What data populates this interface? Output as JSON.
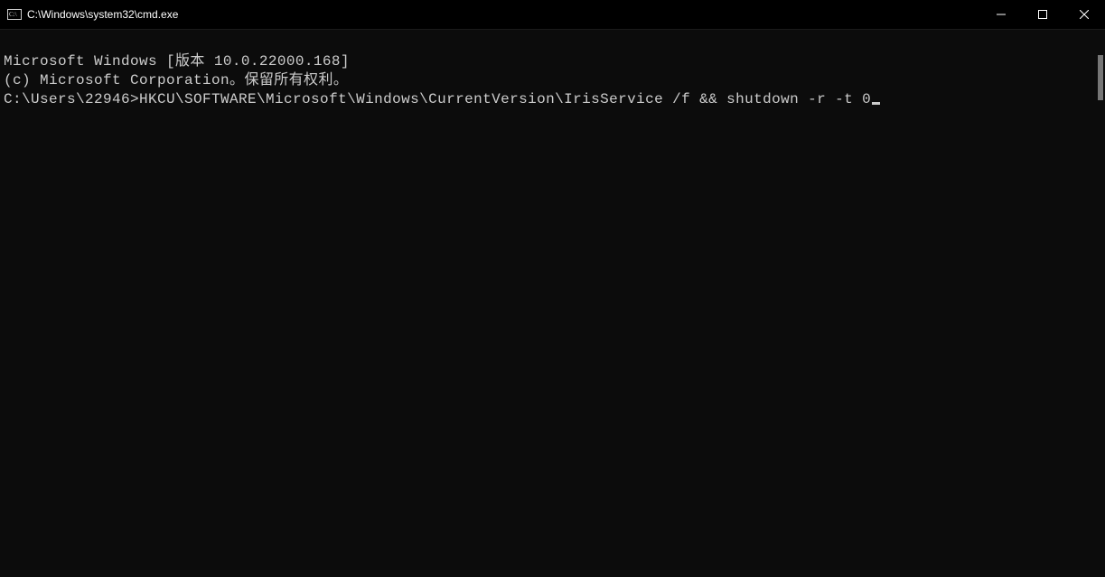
{
  "titlebar": {
    "title": "C:\\Windows\\system32\\cmd.exe"
  },
  "terminal": {
    "line1": "Microsoft Windows [版本 10.0.22000.168]",
    "line2": "(c) Microsoft Corporation。保留所有权利。",
    "line3": "",
    "prompt": "C:\\Users\\22946>",
    "command": "HKCU\\SOFTWARE\\Microsoft\\Windows\\CurrentVersion\\IrisService /f && shutdown -r -t 0"
  }
}
